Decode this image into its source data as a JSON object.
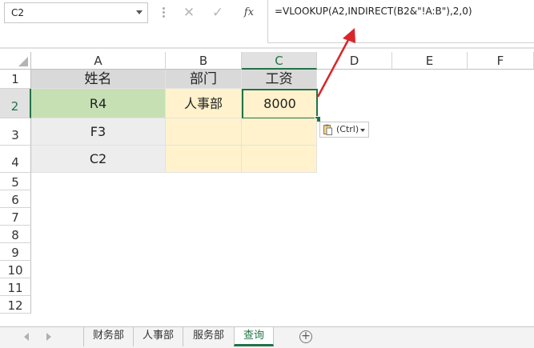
{
  "formula_bar": {
    "name_box": "C2",
    "cancel_icon": "close-icon",
    "enter_icon": "check-icon",
    "fx_label": "fx",
    "formula": "=VLOOKUP(A2,INDIRECT(B2&\"!A:B\"),2,0)"
  },
  "columns": [
    "A",
    "B",
    "C",
    "D",
    "E",
    "F"
  ],
  "rows": [
    "1",
    "2",
    "3",
    "4",
    "5",
    "6",
    "7",
    "8",
    "9",
    "10",
    "11",
    "12"
  ],
  "table": {
    "headers": [
      "姓名",
      "部门",
      "工资"
    ],
    "records": [
      {
        "name": "R4",
        "dept": "人事部",
        "salary": "8000"
      },
      {
        "name": "F3",
        "dept": "",
        "salary": ""
      },
      {
        "name": "C2",
        "dept": "",
        "salary": ""
      }
    ]
  },
  "paste_options": {
    "label": "(Ctrl)",
    "icon": "clipboard-icon"
  },
  "sheet_tabs": [
    "财务部",
    "人事部",
    "服务部",
    "查询"
  ],
  "active_tab": "查询",
  "colors": {
    "accent": "#217346",
    "annotation_arrow": "#d9262b",
    "green_cell": "#c6e0b4",
    "yellow_cell": "#fff2cc",
    "gray_cell": "#ededed"
  }
}
